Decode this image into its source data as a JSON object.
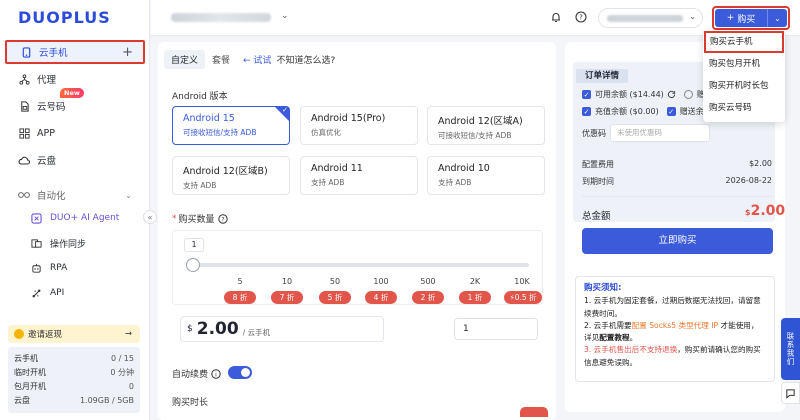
{
  "brand": {
    "logo": "DUOPLUS"
  },
  "sidebar": {
    "items": [
      {
        "label": "云手机",
        "icon": "phone-icon",
        "action": "+"
      },
      {
        "label": "代理",
        "icon": "proxy-icon"
      },
      {
        "label": "云号码",
        "icon": "sim-icon",
        "badge": "New"
      },
      {
        "label": "APP",
        "icon": "apps-icon"
      },
      {
        "label": "云盘",
        "icon": "cloud-icon"
      },
      {
        "label": "自动化",
        "icon": "automation-icon"
      }
    ],
    "sub_items": [
      {
        "label": "DUO+ AI Agent",
        "icon": "ai-agent-icon"
      },
      {
        "label": "操作同步",
        "icon": "sync-icon"
      },
      {
        "label": "RPA",
        "icon": "rpa-icon"
      },
      {
        "label": "API",
        "icon": "api-icon"
      }
    ],
    "invite": {
      "label": "邀请返现",
      "arrow": "→"
    },
    "stats": [
      {
        "label": "云手机",
        "value": "0 / 15"
      },
      {
        "label": "临时开机",
        "value": "0 分钟"
      },
      {
        "label": "包月开机",
        "value": "0"
      },
      {
        "label": "云盘",
        "value": "1.09GB / 5GB"
      }
    ]
  },
  "topbar": {
    "buy_label": "购买",
    "dropdown_options": [
      "购买云手机",
      "购买包月开机",
      "购买开机时长包",
      "购买云号码"
    ]
  },
  "main": {
    "tabs": [
      "自定义",
      "套餐"
    ],
    "try_link": "← 试试",
    "try_hint": "不知道怎么选?",
    "android_label": "Android 版本",
    "versions": [
      {
        "name": "Android 15",
        "desc": "可接收短信/支持 ADB"
      },
      {
        "name": "Android 15(Pro)",
        "desc": "仿真优化"
      },
      {
        "name": "Android 12(区域A)",
        "desc": "可接收短信/支持 ADB"
      },
      {
        "name": "Android 12(区域B)",
        "desc": "支持 ADB"
      },
      {
        "name": "Android 11",
        "desc": "支持 ADB"
      },
      {
        "name": "Android 10",
        "desc": "支持 ADB"
      }
    ],
    "qty_label": "购买数量",
    "qty_required": "*",
    "slider_value": "1",
    "slider_ticks": [
      "5",
      "10",
      "50",
      "100",
      "500",
      "2K",
      "10K"
    ],
    "discounts": [
      "8 折",
      "7 折",
      "5 折",
      "4 折",
      "2 折",
      "1 折",
      "⚡0.5 折"
    ],
    "price_currency": "$",
    "price_amount": "2.00",
    "price_unit": "/ 云手机",
    "qty_input_value": "1",
    "auto_renew_label": "自动续费",
    "duration_label": "购买时长"
  },
  "order": {
    "title": "订单详情",
    "balance": "可用余额 ($14.44)",
    "balance2_prefix": "赠",
    "recharge": "充值余额 ($0.00)",
    "gift": "赠送余额",
    "coupon_label": "优惠码",
    "coupon_placeholder": "未使用优惠码",
    "config_fee_label": "配置费用",
    "config_fee": "$2.00",
    "expire_label": "到期时间",
    "expire": "2026-08-22",
    "total_label": "总金额",
    "total_symbol": "$",
    "total": "2.00",
    "pay_label": "立即购买",
    "notice_title": "购买须知:",
    "notice_1": "1. 云手机为固定套餐，过期后数据无法找回，请留意续费时间。",
    "notice_2a": "2. 云手机需要",
    "notice_2b": "配置 Socks5 类型代理 IP",
    "notice_2c": " 才能使用，详见",
    "notice_2d": "配置教程",
    "notice_2e": "。",
    "notice_3a": "3. 云手机售出后不支持退换",
    "notice_3b": "，购买前请确认您的购买信息避免误购。"
  },
  "contact": {
    "label": "联系我们"
  },
  "colors": {
    "primary": "#3b5bdb",
    "danger": "#e2554a",
    "highlight": "#d93b2f"
  }
}
